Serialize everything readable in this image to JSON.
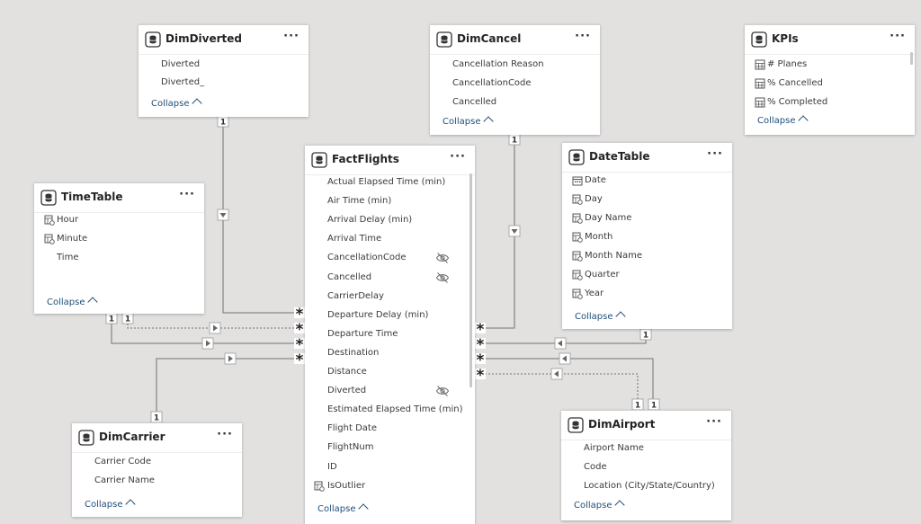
{
  "tables": {
    "dim_diverted": {
      "title": "DimDiverted",
      "more": "···",
      "collapse": "Collapse",
      "fields": [
        {
          "name": "Diverted"
        },
        {
          "name": "Diverted_"
        }
      ]
    },
    "dim_cancel": {
      "title": "DimCancel",
      "more": "···",
      "collapse": "Collapse",
      "fields": [
        {
          "name": "Cancellation Reason"
        },
        {
          "name": "CancellationCode"
        },
        {
          "name": "Cancelled"
        }
      ]
    },
    "kpis": {
      "title": "KPIs",
      "more": "···",
      "collapse": "Collapse",
      "fields": [
        {
          "name": "# Planes",
          "icon": "measure-icon"
        },
        {
          "name": "% Cancelled",
          "icon": "measure-icon"
        },
        {
          "name": "% Completed",
          "icon": "measure-icon"
        }
      ]
    },
    "time_table": {
      "title": "TimeTable",
      "more": "···",
      "collapse": "Collapse",
      "fields": [
        {
          "name": "Hour",
          "icon": "hierarchy-icon"
        },
        {
          "name": "Minute",
          "icon": "hierarchy-icon"
        },
        {
          "name": "Time"
        }
      ]
    },
    "fact_flights": {
      "title": "FactFlights",
      "more": "···",
      "collapse": "Collapse",
      "fields": [
        {
          "name": "Actual Elapsed Time (min)"
        },
        {
          "name": "Air Time (min)"
        },
        {
          "name": "Arrival Delay (min)"
        },
        {
          "name": "Arrival Time"
        },
        {
          "name": "CancellationCode",
          "hidden": true
        },
        {
          "name": "Cancelled",
          "hidden": true
        },
        {
          "name": "CarrierDelay"
        },
        {
          "name": "Departure Delay (min)"
        },
        {
          "name": "Departure Time"
        },
        {
          "name": "Destination"
        },
        {
          "name": "Distance"
        },
        {
          "name": "Diverted",
          "hidden": true
        },
        {
          "name": "Estimated Elapsed Time (min)"
        },
        {
          "name": "Flight Date"
        },
        {
          "name": "FlightNum"
        },
        {
          "name": "ID"
        },
        {
          "name": "IsOutlier",
          "icon": "hierarchy-icon"
        }
      ]
    },
    "date_table": {
      "title": "DateTable",
      "more": "···",
      "collapse": "Collapse",
      "fields": [
        {
          "name": "Date",
          "icon": "calendar-icon"
        },
        {
          "name": "Day",
          "icon": "hierarchy-icon"
        },
        {
          "name": "Day Name",
          "icon": "hierarchy-icon"
        },
        {
          "name": "Month",
          "icon": "hierarchy-icon"
        },
        {
          "name": "Month Name",
          "icon": "hierarchy-icon"
        },
        {
          "name": "Quarter",
          "icon": "hierarchy-icon"
        },
        {
          "name": "Year",
          "icon": "hierarchy-icon"
        }
      ]
    },
    "dim_carrier": {
      "title": "DimCarrier",
      "more": "···",
      "collapse": "Collapse",
      "fields": [
        {
          "name": "Carrier Code"
        },
        {
          "name": "Carrier Name"
        }
      ]
    },
    "dim_airport": {
      "title": "DimAirport",
      "more": "···",
      "collapse": "Collapse",
      "fields": [
        {
          "name": "Airport Name"
        },
        {
          "name": "Code"
        },
        {
          "name": "Location (City/State/Country)"
        }
      ]
    }
  },
  "relationships": [
    {
      "from": "DimDiverted",
      "to": "FactFlights",
      "one": "1",
      "many": "*"
    },
    {
      "from": "TimeTable",
      "to": "FactFlights",
      "one": "1",
      "many": "*"
    },
    {
      "from": "TimeTable",
      "to": "FactFlights",
      "one": "1",
      "many": "*",
      "inactive": true
    },
    {
      "from": "DimCarrier",
      "to": "FactFlights",
      "one": "1",
      "many": "*"
    },
    {
      "from": "DimCancel",
      "to": "FactFlights",
      "one": "1",
      "many": "*"
    },
    {
      "from": "DateTable",
      "to": "FactFlights",
      "one": "1",
      "many": "*"
    },
    {
      "from": "DimAirport",
      "to": "FactFlights",
      "one": "1",
      "many": "*"
    },
    {
      "from": "DimAirport",
      "to": "FactFlights",
      "one": "1",
      "many": "*",
      "inactive": true
    }
  ],
  "colors": {
    "background": "#e2e1e0",
    "card": "#ffffff",
    "line": "#8a8a8a",
    "link": "#1f4e79"
  }
}
